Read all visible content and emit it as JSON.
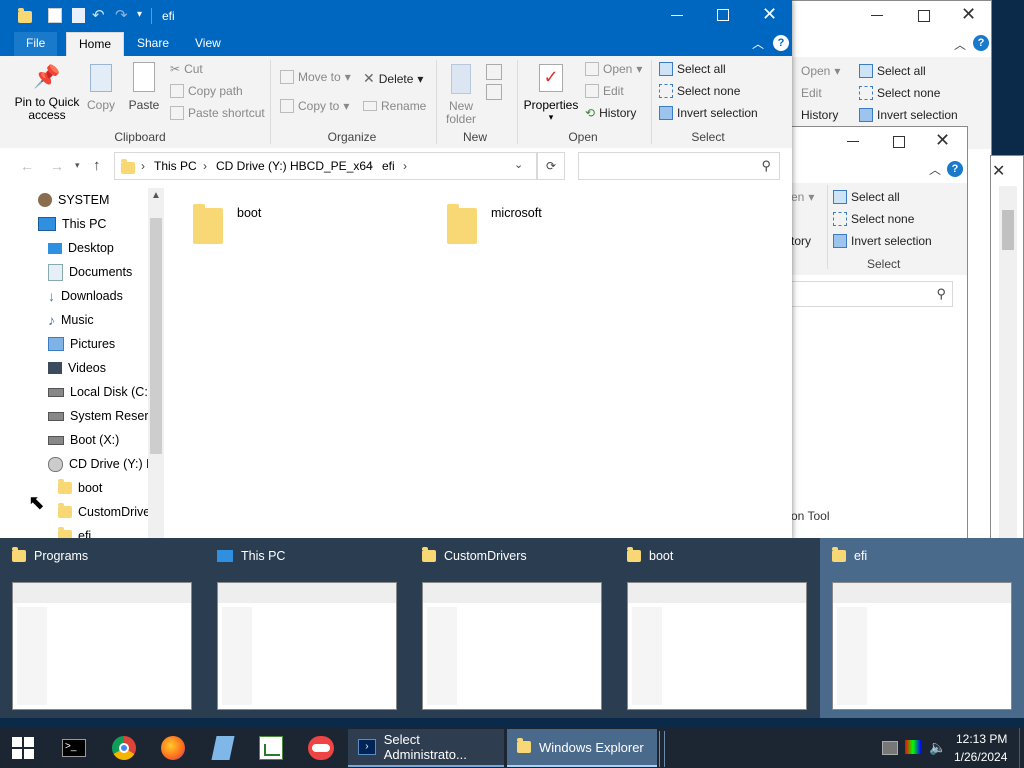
{
  "main_window": {
    "title": "efi",
    "tabs": [
      "File",
      "Home",
      "Share",
      "View"
    ],
    "clipboard": {
      "pin": "Pin to Quick access",
      "copy": "Copy",
      "paste": "Paste",
      "cut": "Cut",
      "copy_path": "Copy path",
      "paste_shortcut": "Paste shortcut",
      "label": "Clipboard"
    },
    "organize": {
      "move_to": "Move to",
      "copy_to": "Copy to",
      "delete": "Delete",
      "rename": "Rename",
      "label": "Organize"
    },
    "new": {
      "new_folder": "New folder",
      "label": "New"
    },
    "open": {
      "properties": "Properties",
      "open": "Open",
      "edit": "Edit",
      "history": "History",
      "label": "Open"
    },
    "select": {
      "select_all": "Select all",
      "select_none": "Select none",
      "invert": "Invert selection",
      "label": "Select"
    },
    "breadcrumb": [
      "This PC",
      "CD Drive (Y:) HBCD_PE_x64",
      "efi"
    ],
    "nav": [
      {
        "label": "SYSTEM",
        "icon": "user-icon"
      },
      {
        "label": "This PC",
        "icon": "computer-icon"
      },
      {
        "label": "Desktop",
        "icon": "desktop-icon"
      },
      {
        "label": "Documents",
        "icon": "documents-icon"
      },
      {
        "label": "Downloads",
        "icon": "download-icon"
      },
      {
        "label": "Music",
        "icon": "music-icon"
      },
      {
        "label": "Pictures",
        "icon": "pictures-icon"
      },
      {
        "label": "Videos",
        "icon": "videos-icon"
      },
      {
        "label": "Local Disk (C:)",
        "icon": "drive-icon"
      },
      {
        "label": "System Reserve",
        "icon": "drive-icon"
      },
      {
        "label": "Boot (X:)",
        "icon": "drive-icon"
      },
      {
        "label": "CD Drive (Y:) H",
        "icon": "cd-drive-icon"
      },
      {
        "label": "boot",
        "icon": "folder-icon"
      },
      {
        "label": "CustomDrive",
        "icon": "folder-icon"
      },
      {
        "label": "efi",
        "icon": "folder-icon"
      }
    ],
    "folders": [
      "boot",
      "microsoft"
    ]
  },
  "bg_window_1": {
    "open": "Open",
    "edit": "Edit",
    "history": "History",
    "select_all": "Select all",
    "select_none": "Select none",
    "invert": "Invert selection"
  },
  "bg_window_2": {
    "open": "en",
    "history": "tory",
    "select_all": "Select all",
    "select_none": "Select none",
    "invert": "Invert selection",
    "label": "Select",
    "status": "on Tool"
  },
  "thumbnails": [
    "Programs",
    "This PC",
    "CustomDrivers",
    "boot",
    "efi"
  ],
  "taskbar": {
    "btn1": "Select Administrato...",
    "btn2": "Windows Explorer",
    "time": "12:13 PM",
    "date": "1/26/2024"
  },
  "colors": {
    "titlebar": "#0067c0",
    "folder": "#f8d775",
    "taskbar": "#1c2633",
    "strip": "#2b3d50"
  }
}
